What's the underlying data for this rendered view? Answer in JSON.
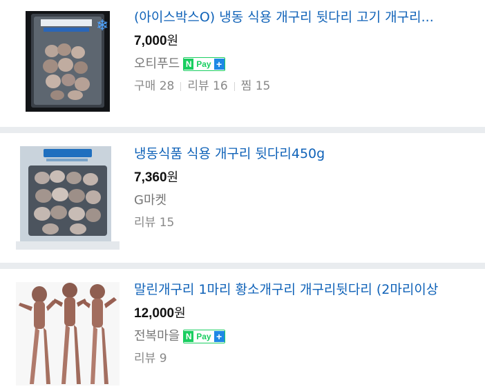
{
  "products": [
    {
      "title": "(아이스박스O) 냉동 식용 개구리 뒷다리 고기 개구리...",
      "price": "7,000",
      "currency": "원",
      "seller": "오티푸드",
      "npay": true,
      "npay_n": "N",
      "npay_label": "Pay",
      "npay_plus": "+",
      "stats": [
        {
          "label": "구매",
          "value": "28"
        },
        {
          "label": "리뷰",
          "value": "16"
        },
        {
          "label": "찜",
          "value": "15"
        }
      ]
    },
    {
      "title": "냉동식품 식용 개구리 뒷다리450g",
      "price": "7,360",
      "currency": "원",
      "seller": "G마켓",
      "npay": false,
      "stats": [
        {
          "label": "리뷰",
          "value": "15"
        }
      ]
    },
    {
      "title": "말린개구리 1마리 황소개구리 개구리뒷다리 (2마리이상",
      "price": "12,000",
      "currency": "원",
      "seller": "전복마을",
      "npay": true,
      "npay_n": "N",
      "npay_label": "Pay",
      "npay_plus": "+",
      "stats": [
        {
          "label": "리뷰",
          "value": "9"
        }
      ]
    }
  ],
  "colors": {
    "title_link": "#0f62b8",
    "separator": "#e9ecef",
    "npay_green": "#19ce60",
    "npay_blue": "#1e88e5"
  },
  "icons": [
    "frozen-frog-legs-package-image",
    "frozen-frog-legs-bag-image",
    "dried-frogs-image",
    "snowflake-icon"
  ]
}
